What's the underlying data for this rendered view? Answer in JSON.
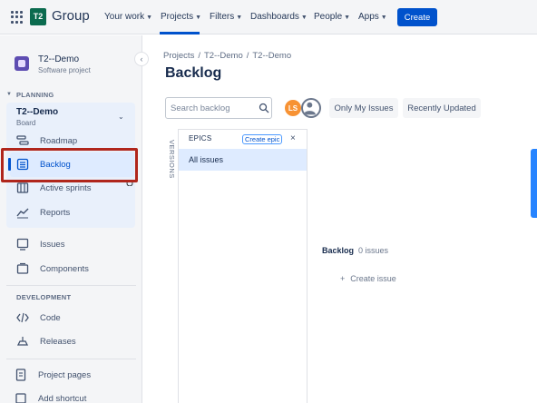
{
  "topnav": {
    "logo_badge": "T2",
    "logo_text": "Group",
    "items": [
      {
        "label": "Your work"
      },
      {
        "label": "Projects"
      },
      {
        "label": "Filters"
      },
      {
        "label": "Dashboards"
      },
      {
        "label": "People"
      },
      {
        "label": "Apps"
      }
    ],
    "create_label": "Create",
    "active_item": "Projects",
    "accent": "#0052cc"
  },
  "sidebar": {
    "project_name": "T2--Demo",
    "project_type": "Software project",
    "planning_label": "PLANNING",
    "board_name": "T2--Demo",
    "board_sub": "Board",
    "planning_items": [
      {
        "label": "Roadmap",
        "icon": "roadmap-icon"
      },
      {
        "label": "Backlog",
        "icon": "backlog-icon",
        "selected": true
      },
      {
        "label": "Active sprints",
        "icon": "sprints-icon"
      },
      {
        "label": "Reports",
        "icon": "reports-icon"
      }
    ],
    "other_items": [
      {
        "label": "Issues",
        "icon": "issues-icon"
      },
      {
        "label": "Components",
        "icon": "components-icon"
      }
    ],
    "development_label": "DEVELOPMENT",
    "dev_items": [
      {
        "label": "Code",
        "icon": "code-icon"
      },
      {
        "label": "Releases",
        "icon": "releases-icon"
      }
    ],
    "bottom_items": [
      {
        "label": "Project pages",
        "icon": "pages-icon"
      },
      {
        "label": "Add shortcut",
        "icon": "shortcut-icon"
      }
    ],
    "highlight_color": "#b0261c"
  },
  "main": {
    "breadcrumb": [
      "Projects",
      "T2--Demo",
      "T2--Demo"
    ],
    "breadcrumb_sep": "/",
    "title": "Backlog",
    "search_placeholder": "Search backlog",
    "avatar_initials": "LS",
    "filters": [
      {
        "label": "Only My Issues"
      },
      {
        "label": "Recently Updated"
      }
    ],
    "versions_label": "VERSIONS",
    "epics_label": "EPICS",
    "create_epic_label": "Create epic",
    "epic_close": "×",
    "all_issues_label": "All issues",
    "backlog_section_label": "Backlog",
    "backlog_count": "0 issues",
    "create_issue_plus": "+",
    "create_issue_label": "Create issue"
  }
}
